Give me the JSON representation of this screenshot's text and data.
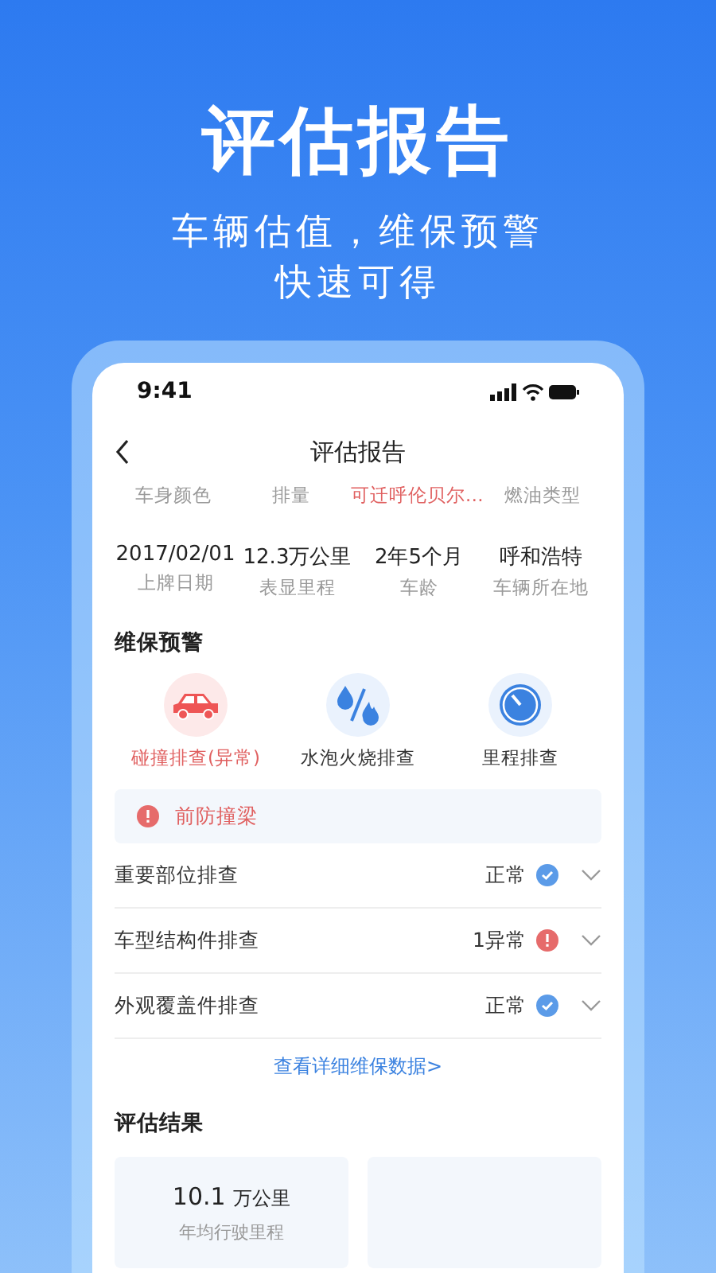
{
  "headline": "评估报告",
  "subtitle_lines": [
    "车辆估值，维保预警",
    "快速可得"
  ],
  "status_bar": {
    "time": "9:41"
  },
  "nav": {
    "title": "评估报告"
  },
  "attributes": [
    {
      "label": "车身颜色",
      "alert": false
    },
    {
      "label": "排量",
      "alert": false
    },
    {
      "label": "可迁呼伦贝尔…",
      "alert": true
    },
    {
      "label": "燃油类型",
      "alert": false
    }
  ],
  "facts": [
    {
      "value": "2017/02/01",
      "label": "上牌日期"
    },
    {
      "value": "12.3万公里",
      "label": "表显里程"
    },
    {
      "value": "2年5个月",
      "label": "车龄"
    },
    {
      "value": "呼和浩特",
      "label": "车辆所在地"
    }
  ],
  "maintenance": {
    "title": "维保预警",
    "items": [
      {
        "kind": "car",
        "label": "碰撞排查(异常)",
        "abnormal": true
      },
      {
        "kind": "water-fire",
        "label": "水泡火烧排查",
        "abnormal": false
      },
      {
        "kind": "gauge",
        "label": "里程排查",
        "abnormal": false
      }
    ],
    "alert": "前防撞梁",
    "checks": [
      {
        "label": "重要部位排查",
        "status": "正常",
        "kind": "normal",
        "expanded": false
      },
      {
        "label": "车型结构件排查",
        "status": "1异常",
        "kind": "abnormal",
        "expanded": false
      },
      {
        "label": "外观覆盖件排查",
        "status": "正常",
        "kind": "normal",
        "expanded": false
      }
    ],
    "link": "查看详细维保数据>"
  },
  "result": {
    "title": "评估结果",
    "cards": [
      {
        "value": "10.1",
        "unit": "万公里",
        "label": "年均行驶里程"
      }
    ]
  }
}
